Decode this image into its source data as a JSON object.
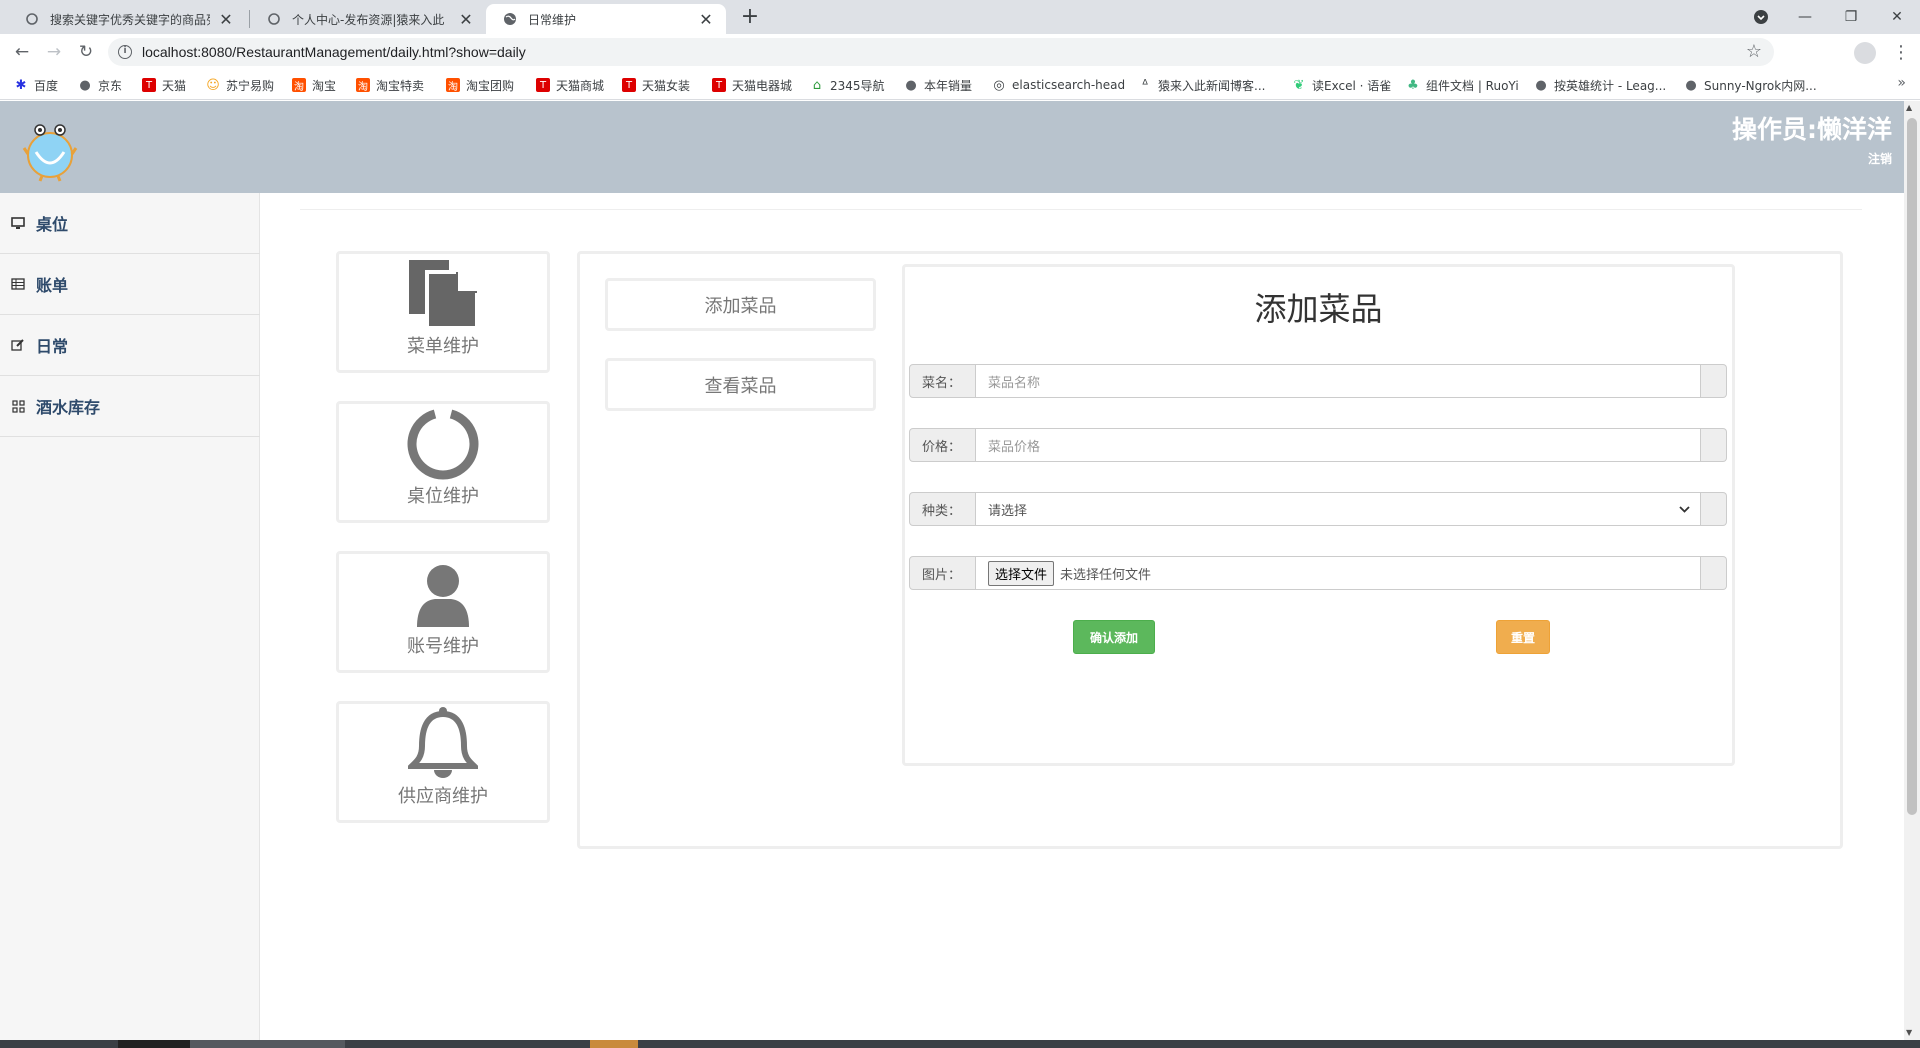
{
  "browser": {
    "tabs": [
      {
        "title": "搜索关键字优秀关键字的商品列表",
        "active": false
      },
      {
        "title": "个人中心-发布资源|猿来入此【b",
        "active": false
      },
      {
        "title": "日常维护",
        "active": true
      }
    ],
    "new_tab": "+",
    "url": "localhost:8080/RestaurantManagement/daily.html?show=daily",
    "bookmarks": [
      {
        "label": "百度",
        "icon": "paw-icon",
        "color": "#2932e1"
      },
      {
        "label": "京东",
        "icon": "globe-icon",
        "color": "#5f6368"
      },
      {
        "label": "天猫",
        "icon": "tmall-icon",
        "color": "#d00"
      },
      {
        "label": "苏宁易购",
        "icon": "suning-icon",
        "color": "#f5a623"
      },
      {
        "label": "淘宝",
        "icon": "taobao-icon",
        "color": "#ff5000"
      },
      {
        "label": "淘宝特卖",
        "icon": "taobao-icon",
        "color": "#ff5000"
      },
      {
        "label": "淘宝团购",
        "icon": "taobao-icon",
        "color": "#ff5000"
      },
      {
        "label": "天猫商城",
        "icon": "tmall-icon",
        "color": "#d00"
      },
      {
        "label": "天猫女装",
        "icon": "tmall-icon",
        "color": "#d00"
      },
      {
        "label": "天猫电器城",
        "icon": "tmall-icon",
        "color": "#d00"
      },
      {
        "label": "2345导航",
        "icon": "house-icon",
        "color": "#2e9b3c"
      },
      {
        "label": "本年销量",
        "icon": "globe-icon",
        "color": "#5f6368"
      },
      {
        "label": "elasticsearch-head",
        "icon": "elastic-icon",
        "color": "#3c4043"
      },
      {
        "label": "猿来入此新闻博客...",
        "icon": "ape-icon",
        "color": "#3c4043"
      },
      {
        "label": "读Excel · 语雀",
        "icon": "leaf-icon",
        "color": "#31cc79"
      },
      {
        "label": "组件文档 | RuoYi",
        "icon": "ruoyi-icon",
        "color": "#41b883"
      },
      {
        "label": "按英雄统计 - Leag...",
        "icon": "globe-icon",
        "color": "#5f6368"
      },
      {
        "label": "Sunny-Ngrok内网...",
        "icon": "globe-icon",
        "color": "#5f6368"
      }
    ]
  },
  "header": {
    "operator": "操作员:懒洋洋",
    "logout": "注销"
  },
  "sidebar": {
    "items": [
      {
        "label": "桌位",
        "icon": "monitor-icon"
      },
      {
        "label": "账单",
        "icon": "table-icon"
      },
      {
        "label": "日常",
        "icon": "edit-icon"
      },
      {
        "label": "酒水库存",
        "icon": "grid-icon"
      }
    ]
  },
  "tiles": [
    {
      "label": "菜单维护",
      "icon": "file-icon"
    },
    {
      "label": "桌位维护",
      "icon": "circle-icon"
    },
    {
      "label": "账号维护",
      "icon": "user-icon"
    },
    {
      "label": "供应商维护",
      "icon": "bell-icon"
    }
  ],
  "subnav": {
    "add": "添加菜品",
    "view": "查看菜品"
  },
  "form": {
    "title": "添加菜品",
    "name_label": "菜名：",
    "name_placeholder": "菜品名称",
    "price_label": "价格：",
    "price_placeholder": "菜品价格",
    "type_label": "种类：",
    "type_value": "请选择",
    "image_label": "图片：",
    "file_button": "选择文件",
    "file_status": "未选择任何文件",
    "submit": "确认添加",
    "reset": "重置"
  },
  "colors": {
    "header_bg": "#b8c3cd",
    "success": "#5cb85c",
    "warning": "#f0ad4e",
    "sidebar_text": "#2e4a6b"
  }
}
